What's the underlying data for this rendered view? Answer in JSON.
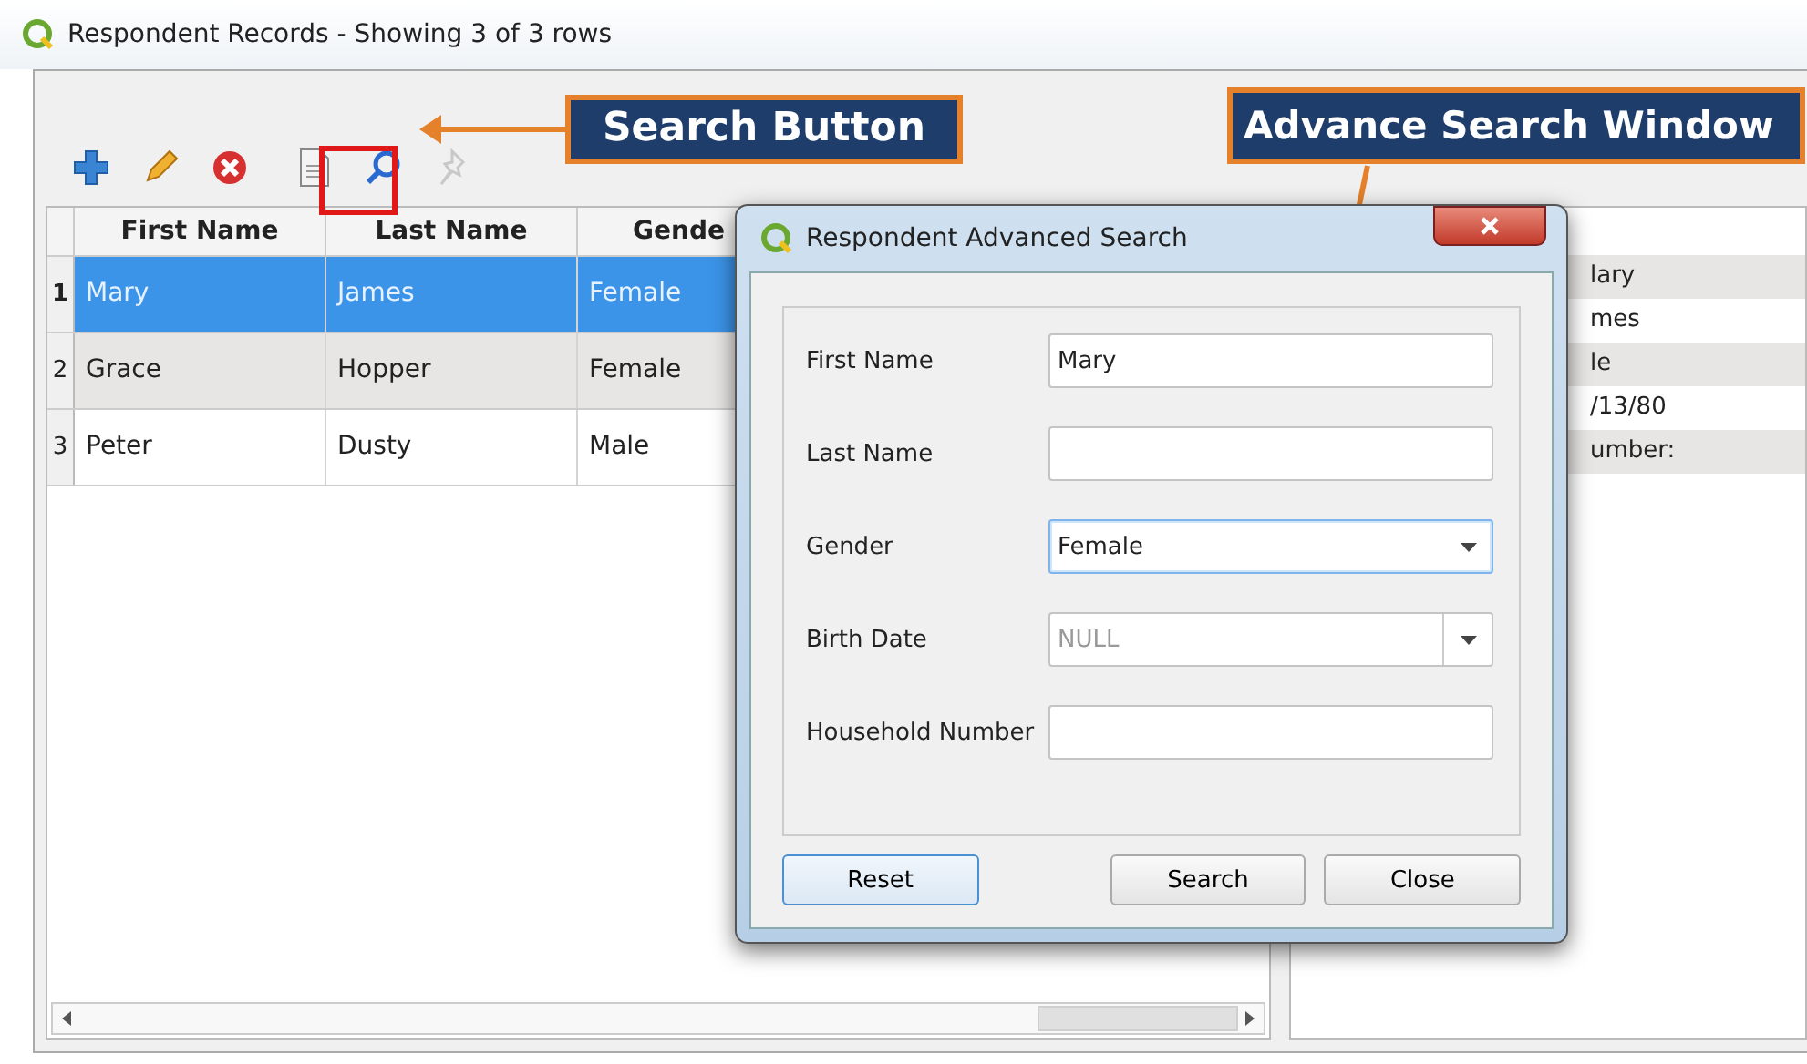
{
  "window": {
    "title": "Respondent Records - Showing 3 of 3 rows"
  },
  "toolbar": [
    {
      "disabled": false
    },
    {
      "disabled": false
    },
    {
      "disabled": false
    },
    {
      "disabled": false
    },
    {
      "disabled": false,
      "highlighted": true
    },
    {
      "disabled": true
    }
  ],
  "table": {
    "columns": [
      "First Name",
      "Last Name",
      "Gende"
    ],
    "rows": [
      {
        "number": "1",
        "selected": true,
        "cells": [
          "Mary",
          "James",
          "Female"
        ]
      },
      {
        "number": "2",
        "selected": false,
        "cells": [
          "Grace",
          "Hopper",
          "Female"
        ]
      },
      {
        "number": "3",
        "selected": false,
        "cells": [
          "Peter",
          "Dusty",
          "Male"
        ]
      }
    ]
  },
  "detail_panel": {
    "values": [
      "lary",
      "mes",
      "le",
      "/13/80",
      "umber:"
    ]
  },
  "dialog": {
    "title": "Respondent Advanced Search",
    "fields": [
      {
        "label": "First Name",
        "kind": "text",
        "value": "Mary",
        "focused": false
      },
      {
        "label": "Last Name",
        "kind": "text",
        "focused": false
      },
      {
        "label": "Gender",
        "kind": "combo",
        "value": "Female",
        "focused": true
      },
      {
        "label": "Birth Date",
        "kind": "date",
        "placeholder": "NULL",
        "focused": false
      },
      {
        "label": "Household Number",
        "kind": "text",
        "focused": false
      }
    ],
    "buttons": [
      {
        "label": "Reset",
        "default": true
      },
      {
        "label": "Search",
        "default": false
      },
      {
        "label": "Close",
        "default": false
      }
    ]
  },
  "annotations": [
    {
      "text": "Search Button"
    },
    {
      "text": "Advance Search Window"
    }
  ]
}
